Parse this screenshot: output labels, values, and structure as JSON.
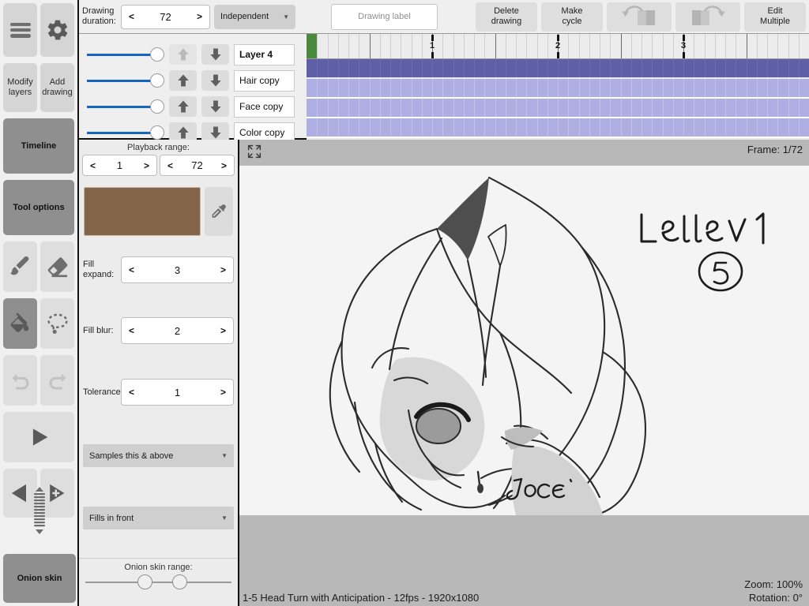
{
  "sidebar": {
    "menu_icon": "hamburger-icon",
    "settings_icon": "gear-icon",
    "modify_layers": "Modify\nlayers",
    "modify_layers_l1": "Modify",
    "modify_layers_l2": "layers",
    "add_drawing_l1": "Add",
    "add_drawing_l2": "drawing",
    "timeline": "Timeline",
    "tool_options": "Tool options",
    "brush_icon": "brush-icon",
    "eraser_icon": "eraser-icon",
    "fill_icon": "fill-bucket-icon",
    "lasso_icon": "lasso-select-icon",
    "undo_icon": "undo-icon",
    "redo_icon": "redo-icon",
    "play_icon": "play-icon",
    "prev_frame_icon": "previous-frame-icon",
    "next_frame_icon": "next-frame-add-icon",
    "frame_scrub_icon": "frame-scrubber-icon",
    "onion_skin": "Onion skin"
  },
  "toolbar": {
    "drawing_duration_label_l1": "Drawing",
    "drawing_duration_label_l2": "duration:",
    "drawing_duration_value": "72",
    "prev_arrow": "<",
    "next_arrow": ">",
    "mode_value": "Independent",
    "drawing_label_placeholder": "Drawing label",
    "delete_drawing_l1": "Delete",
    "delete_drawing_l2": "drawing",
    "make_cycle_l1": "Make",
    "make_cycle_l2": "cycle",
    "flip_back_icon": "flip-backward-icon",
    "flip_forward_icon": "flip-forward-icon",
    "edit_multiple_l1": "Edit",
    "edit_multiple_l2": "Multiple"
  },
  "layers": {
    "up_icon": "move-layer-up-icon",
    "down_icon": "move-layer-down-icon",
    "items": [
      {
        "name": "Layer 4",
        "active": true,
        "opacity": 100,
        "up_disabled": true
      },
      {
        "name": "Hair copy",
        "active": false,
        "opacity": 100,
        "up_disabled": false
      },
      {
        "name": "Face copy",
        "active": false,
        "opacity": 100,
        "up_disabled": false
      },
      {
        "name": "Color  copy",
        "active": false,
        "opacity": 100,
        "up_disabled": false
      }
    ]
  },
  "timeline": {
    "tick_labels": [
      "1",
      "2",
      "3"
    ],
    "playhead_frame": 1,
    "total_cells": 48,
    "selected_track_index": 0,
    "colors": {
      "playhead": "#4a8a3c",
      "track": "#aeaee2",
      "track_selected": "#5f5fa8"
    }
  },
  "tool_options": {
    "playback_range_label": "Playback range:",
    "playback_start": "1",
    "playback_end": "72",
    "prev_arrow": "<",
    "next_arrow": ">",
    "color_swatch": "#85654a",
    "eyedropper_icon": "eyedropper-icon",
    "fill_expand_l1": "Fill",
    "fill_expand_l2": "expand:",
    "fill_expand_value": "3",
    "fill_blur_label": "Fill blur:",
    "fill_blur_value": "2",
    "tolerance_label": "Tolerance:",
    "tolerance_value": "1",
    "sample_mode": "Samples this & above",
    "fill_order": "Fills in front",
    "onion_skin_range_label": "Onion skin range:"
  },
  "canvas": {
    "expand_icon": "expand-canvas-icon",
    "frame_indicator": "Frame: 1/72",
    "project_info": "1-5 Head Turn with Anticipation - 12fps - 1920x1080",
    "zoom": "Zoom: 100%",
    "rotation": "Rotation: 0°",
    "drawing_text_level": "Level 1",
    "drawing_text_number": "5",
    "signature": "JOCE"
  }
}
